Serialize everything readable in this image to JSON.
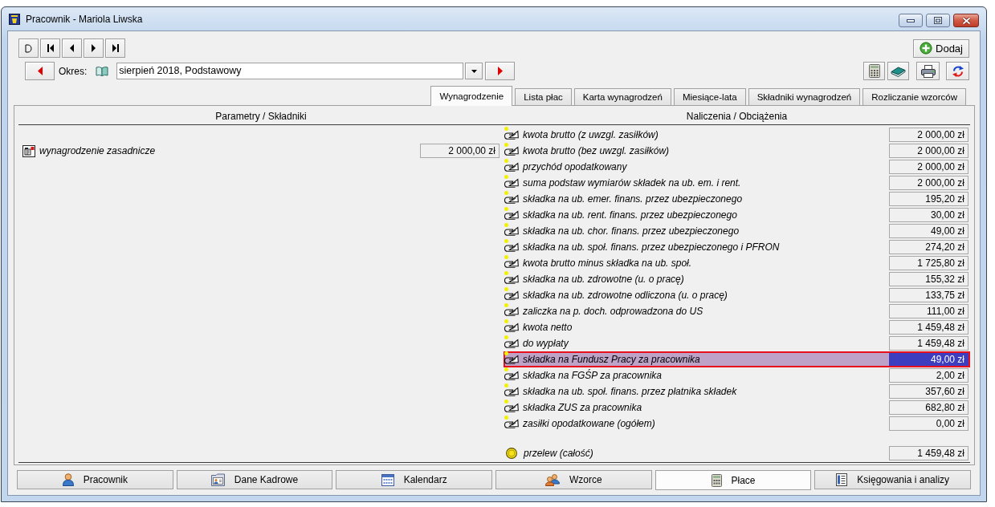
{
  "window": {
    "title": "Pracownik - Mariola Liwska"
  },
  "toolbar": {
    "add_button": "Dodaj"
  },
  "period": {
    "label": "Okres:",
    "value": "sierpień 2018, Podstawowy"
  },
  "tabs": [
    {
      "label": "Wynagrodzenie",
      "selected": true
    },
    {
      "label": "Lista płac",
      "selected": false
    },
    {
      "label": "Karta wynagrodzeń",
      "selected": false
    },
    {
      "label": "Miesiące-lata",
      "selected": false
    },
    {
      "label": "Składniki wynagrodzeń",
      "selected": false
    },
    {
      "label": "Rozliczanie wzorców",
      "selected": false
    }
  ],
  "panel": {
    "left_header": "Parametry / Składniki",
    "right_header": "Naliczenia / Obciążenia",
    "parameters": [
      {
        "label": "wynagrodzenie zasadnicze",
        "value": "2 000,00 zł"
      }
    ],
    "rows": [
      {
        "label": "kwota brutto (z uwzgl. zasiłków)",
        "value": "2 000,00 zł",
        "marked": true,
        "selected": false
      },
      {
        "label": "kwota brutto (bez uwzgl. zasiłków)",
        "value": "2 000,00 zł",
        "marked": true,
        "selected": false
      },
      {
        "label": "przychód opodatkowany",
        "value": "2 000,00 zł",
        "marked": true,
        "selected": false
      },
      {
        "label": "suma podstaw wymiarów składek na ub. em. i rent.",
        "value": "2 000,00 zł",
        "marked": true,
        "selected": false
      },
      {
        "label": "składka na ub. emer. finans. przez ubezpieczonego",
        "value": "195,20 zł",
        "marked": true,
        "selected": false
      },
      {
        "label": "składka na ub. rent. finans. przez ubezpieczonego",
        "value": "30,00 zł",
        "marked": true,
        "selected": false
      },
      {
        "label": "składka na ub. chor. finans. przez ubezpieczonego",
        "value": "49,00 zł",
        "marked": true,
        "selected": false
      },
      {
        "label": "składka na ub. społ. finans. przez ubezpieczonego i PFRON",
        "value": "274,20 zł",
        "marked": true,
        "selected": false
      },
      {
        "label": "kwota brutto minus składka na ub. społ.",
        "value": "1 725,80 zł",
        "marked": true,
        "selected": false
      },
      {
        "label": "składka na ub. zdrowotne (u. o pracę)",
        "value": "155,32 zł",
        "marked": true,
        "selected": false
      },
      {
        "label": "składka na ub. zdrowotne odliczona (u. o pracę)",
        "value": "133,75 zł",
        "marked": true,
        "selected": false
      },
      {
        "label": "zaliczka na p. doch. odprowadzona do US",
        "value": "111,00 zł",
        "marked": true,
        "selected": false
      },
      {
        "label": "kwota netto",
        "value": "1 459,48 zł",
        "marked": true,
        "selected": false
      },
      {
        "label": "do wypłaty",
        "value": "1 459,48 zł",
        "marked": true,
        "selected": false
      },
      {
        "label": "składka na Fundusz Pracy za pracownika",
        "value": "49,00 zł",
        "marked": true,
        "selected": true
      },
      {
        "label": "składka na FGŚP za pracownika",
        "value": "2,00 zł",
        "marked": true,
        "selected": false
      },
      {
        "label": "składka na ub. społ. finans. przez płatnika składek",
        "value": "357,60 zł",
        "marked": true,
        "selected": false
      },
      {
        "label": "składka ZUS za pracownika",
        "value": "682,80 zł",
        "marked": true,
        "selected": false
      },
      {
        "label": "zasiłki opodatkowane (ogółem)",
        "value": "0,00 zł",
        "marked": true,
        "selected": false
      }
    ],
    "total": {
      "label": "przelew (całość)",
      "value": "1 459,48 zł"
    }
  },
  "bottom_tabs": [
    {
      "label": "Pracownik",
      "selected": false
    },
    {
      "label": "Dane Kadrowe",
      "selected": false
    },
    {
      "label": "Kalendarz",
      "selected": false
    },
    {
      "label": "Wzorce",
      "selected": false
    },
    {
      "label": "Płace",
      "selected": true
    },
    {
      "label": "Księgowania i analizy",
      "selected": false
    }
  ]
}
